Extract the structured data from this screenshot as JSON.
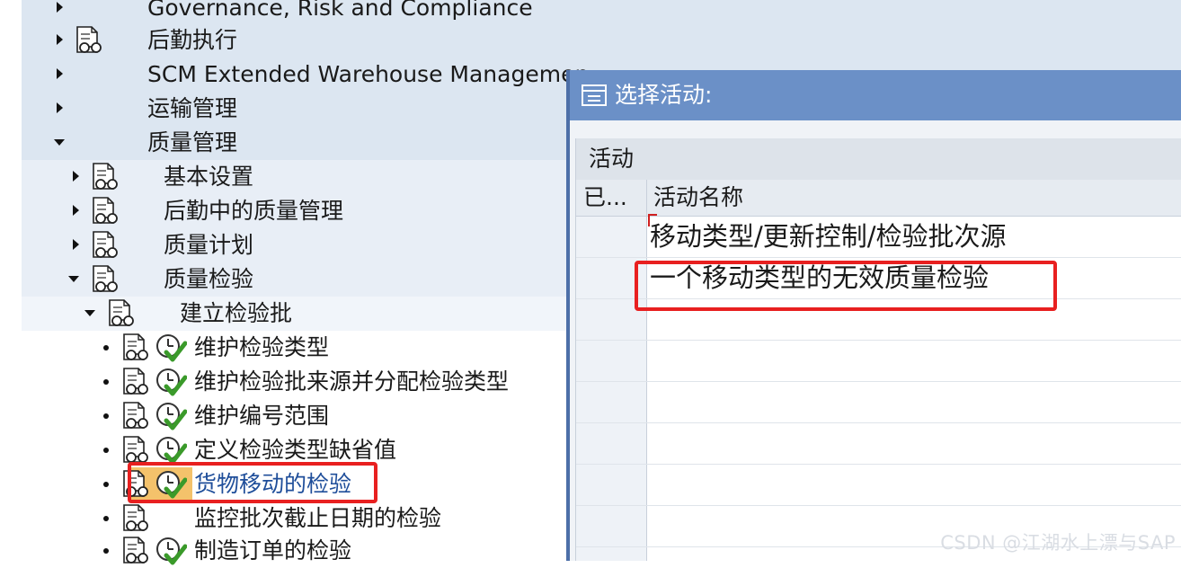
{
  "tree": {
    "items": [
      {
        "label": "Governance, Risk and Compliance"
      },
      {
        "label": "后勤执行"
      },
      {
        "label": "SCM Extended Warehouse Managemen"
      },
      {
        "label": "运输管理"
      },
      {
        "label": "质量管理"
      },
      {
        "label": "基本设置"
      },
      {
        "label": "后勤中的质量管理"
      },
      {
        "label": "质量计划"
      },
      {
        "label": "质量检验"
      },
      {
        "label": "建立检验批"
      },
      {
        "label": "维护检验类型"
      },
      {
        "label": "维护检验批来源并分配检验类型"
      },
      {
        "label": "维护编号范围"
      },
      {
        "label": "定义检验类型缺省值"
      },
      {
        "label": "货物移动的检验"
      },
      {
        "label": "监控批次截止日期的检验"
      },
      {
        "label": "制造订单的检验"
      }
    ]
  },
  "dialog": {
    "title": "选择活动:",
    "caption": "活动",
    "columns": [
      "已...",
      "活动名称"
    ],
    "rows": [
      "移动类型/更新控制/检验批次源",
      "一个移动类型的无效质量检验"
    ]
  },
  "watermark": "CSDN @江湖水上漂与SAP",
  "colors": {
    "highlight_box": "#e82020",
    "dialog_title_bar": "#6b90c7",
    "link_text": "#1f4e9a",
    "selected_icon_bg": "#f4c26b"
  }
}
